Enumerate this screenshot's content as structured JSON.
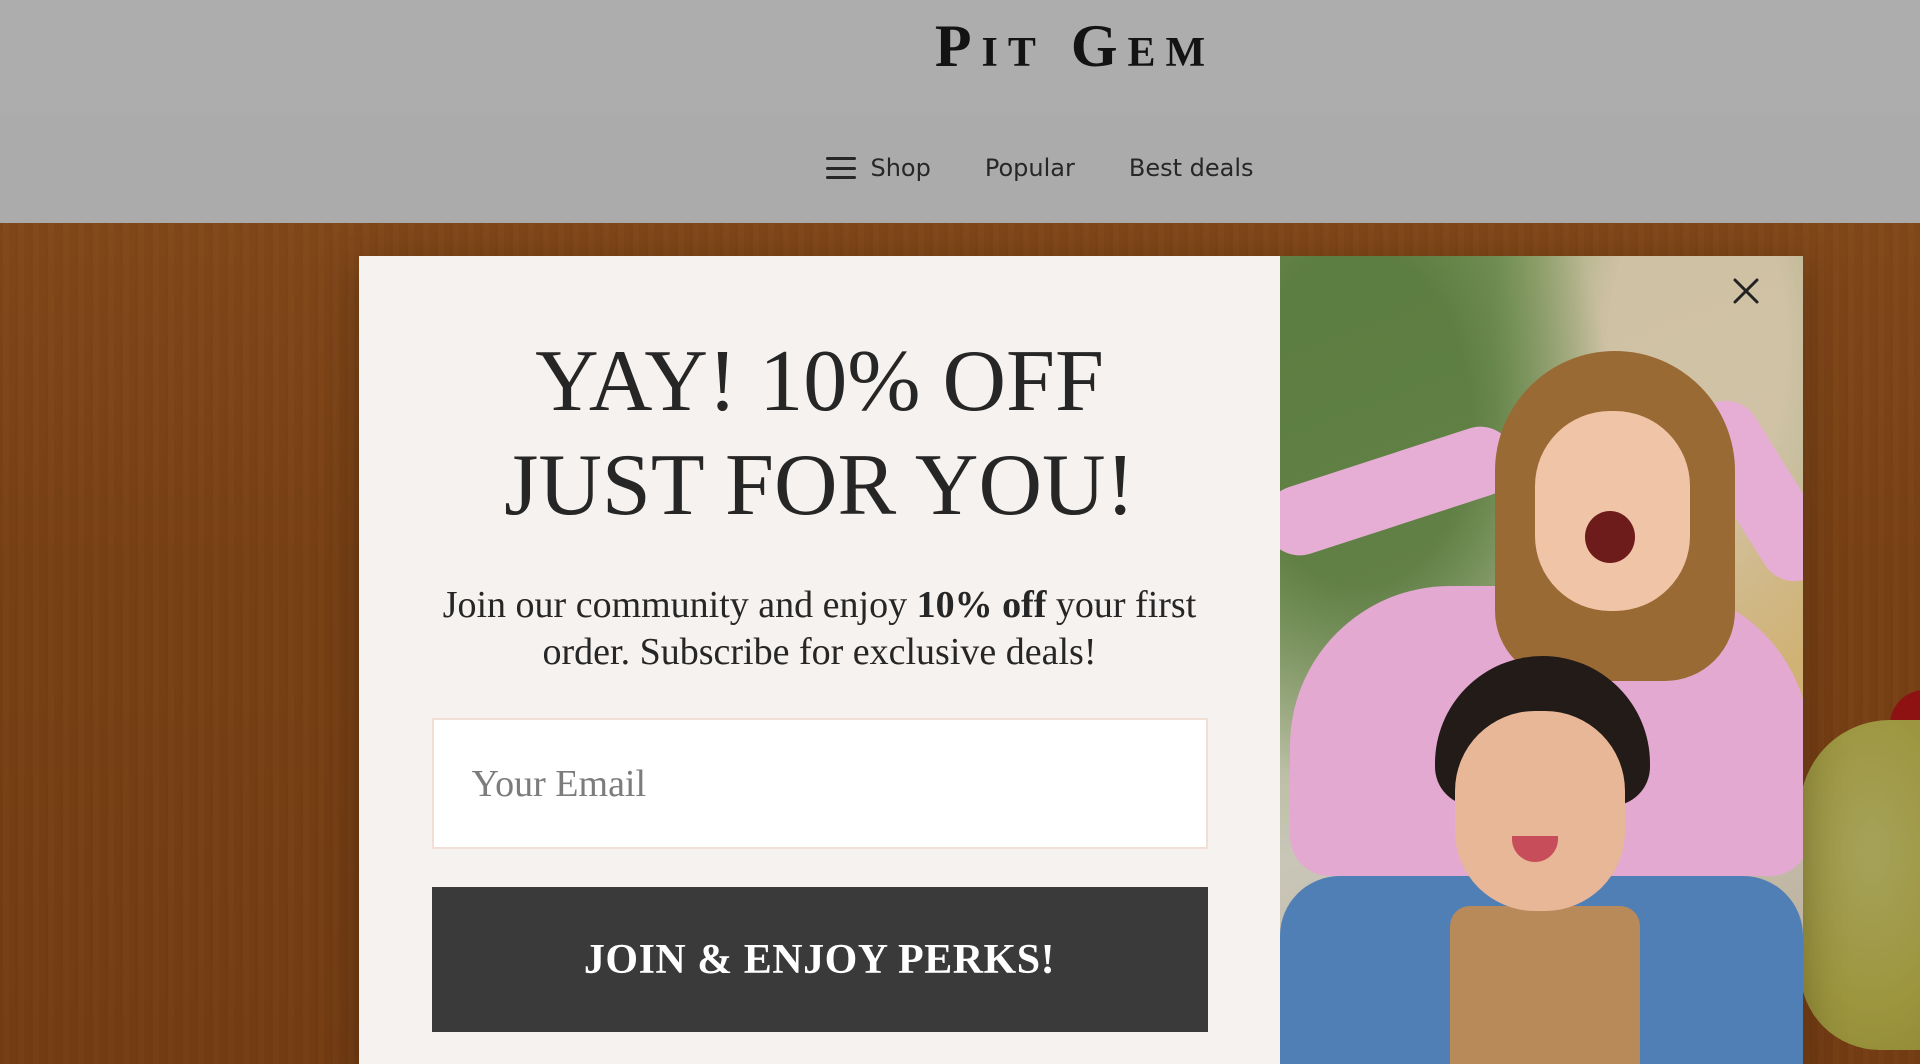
{
  "header": {
    "brand": "Pit Gem"
  },
  "nav": {
    "items": [
      {
        "label": "Shop",
        "icon": "hamburger-menu-icon"
      },
      {
        "label": "Popular"
      },
      {
        "label": "Best deals"
      }
    ]
  },
  "popup": {
    "headline_line1": "YAY! 10% OFF",
    "headline_line2": "JUST FOR YOU!",
    "subtext_before": "Join our community and enjoy ",
    "subtext_bold": "10% off",
    "subtext_after": " your first order. Subscribe for exclusive deals!",
    "email_placeholder": "Your Email",
    "email_value": "",
    "button_label": "JOIN & ENJOY PERKS!",
    "close_icon": "close-icon"
  },
  "colors": {
    "hero_background": "#b05f1f",
    "button_background": "#3a3a3a",
    "popup_background": "#f6f2ef"
  }
}
